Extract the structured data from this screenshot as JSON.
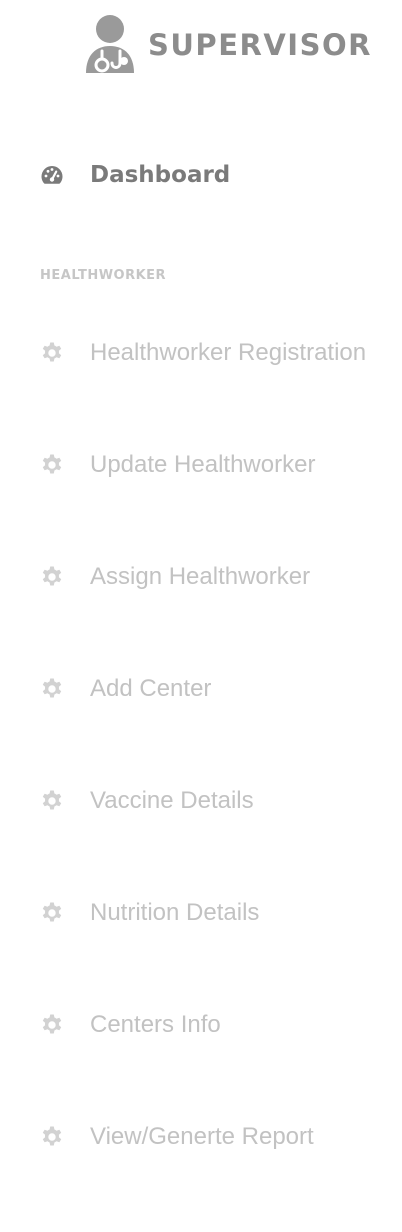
{
  "brand": {
    "title": "SUPERVISOR",
    "icon": "doctor-avatar-icon",
    "color": "#8c8c8c"
  },
  "dashboard": {
    "label": "Dashboard",
    "icon": "gauge-icon",
    "color": "#7a7a7a"
  },
  "section": {
    "heading": "HEALTHWORKER"
  },
  "menu": {
    "icon": "gear-icon",
    "text_color": "#c2c2c2",
    "items": [
      {
        "label": "Healthworker Registration"
      },
      {
        "label": "Update Healthworker"
      },
      {
        "label": "Assign Healthworker"
      },
      {
        "label": "Add Center"
      },
      {
        "label": "Vaccine Details"
      },
      {
        "label": "Nutrition Details"
      },
      {
        "label": "Centers Info"
      },
      {
        "label": "View/Generte Report"
      }
    ]
  }
}
